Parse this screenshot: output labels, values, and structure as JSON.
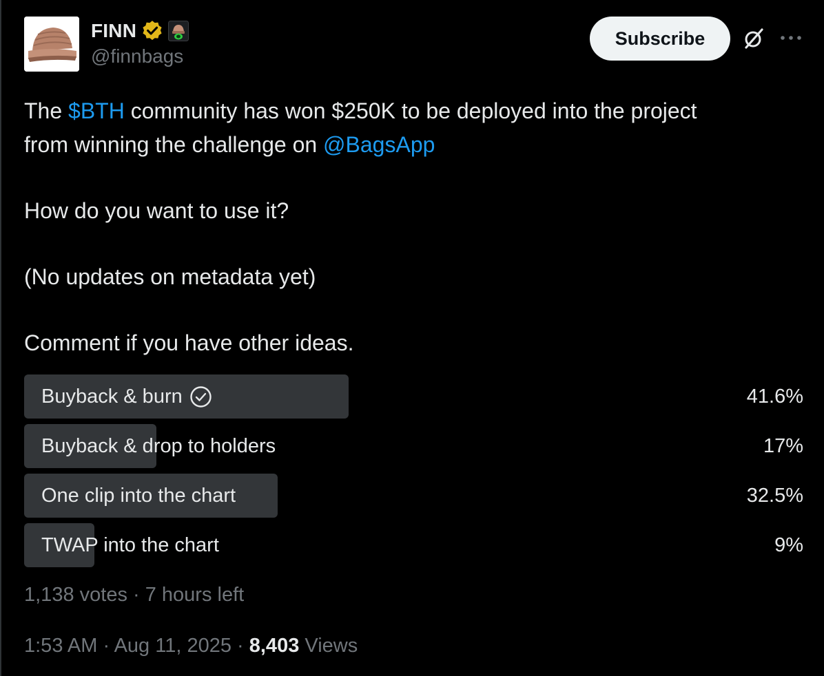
{
  "author": {
    "name": "FINN",
    "handle": "@finnbags"
  },
  "header": {
    "subscribe_label": "Subscribe"
  },
  "tweet": {
    "line1_pre": "The ",
    "cashtag": "$BTH",
    "line1_post": " community has won $250K to be deployed into the project",
    "line2_pre": "from winning the challenge on ",
    "mention": "@BagsApp",
    "line3": "How do you want to use it?",
    "line4": "(No updates on metadata yet)",
    "line5": "Comment if you have other ideas."
  },
  "poll": {
    "options": [
      {
        "label": "Buyback & burn",
        "percent": "41.6%",
        "fraction": 0.416,
        "winner": true
      },
      {
        "label": "Buyback & drop to holders",
        "percent": "17%",
        "fraction": 0.17,
        "winner": false
      },
      {
        "label": "One clip into the chart",
        "percent": "32.5%",
        "fraction": 0.325,
        "winner": false
      },
      {
        "label": "TWAP into the chart",
        "percent": "9%",
        "fraction": 0.09,
        "winner": false
      }
    ],
    "votes": "1,138 votes",
    "time_left": "7 hours left"
  },
  "footer": {
    "time": "1:53 AM",
    "date": "Aug 11, 2025",
    "views_count": "8,403",
    "views_label": "Views"
  },
  "colors": {
    "background": "#000000",
    "text": "#e7e9ea",
    "muted": "#71767b",
    "link": "#1d9bf0",
    "poll_fill": "#333639",
    "verified_gold": "#e2b719"
  },
  "icons": {
    "verified": "verified-gold-badge-icon",
    "emoji": "beanie-emoji-icon",
    "grok": "grok-icon",
    "more": "more-horizontal-icon",
    "check": "check-circle-icon"
  }
}
